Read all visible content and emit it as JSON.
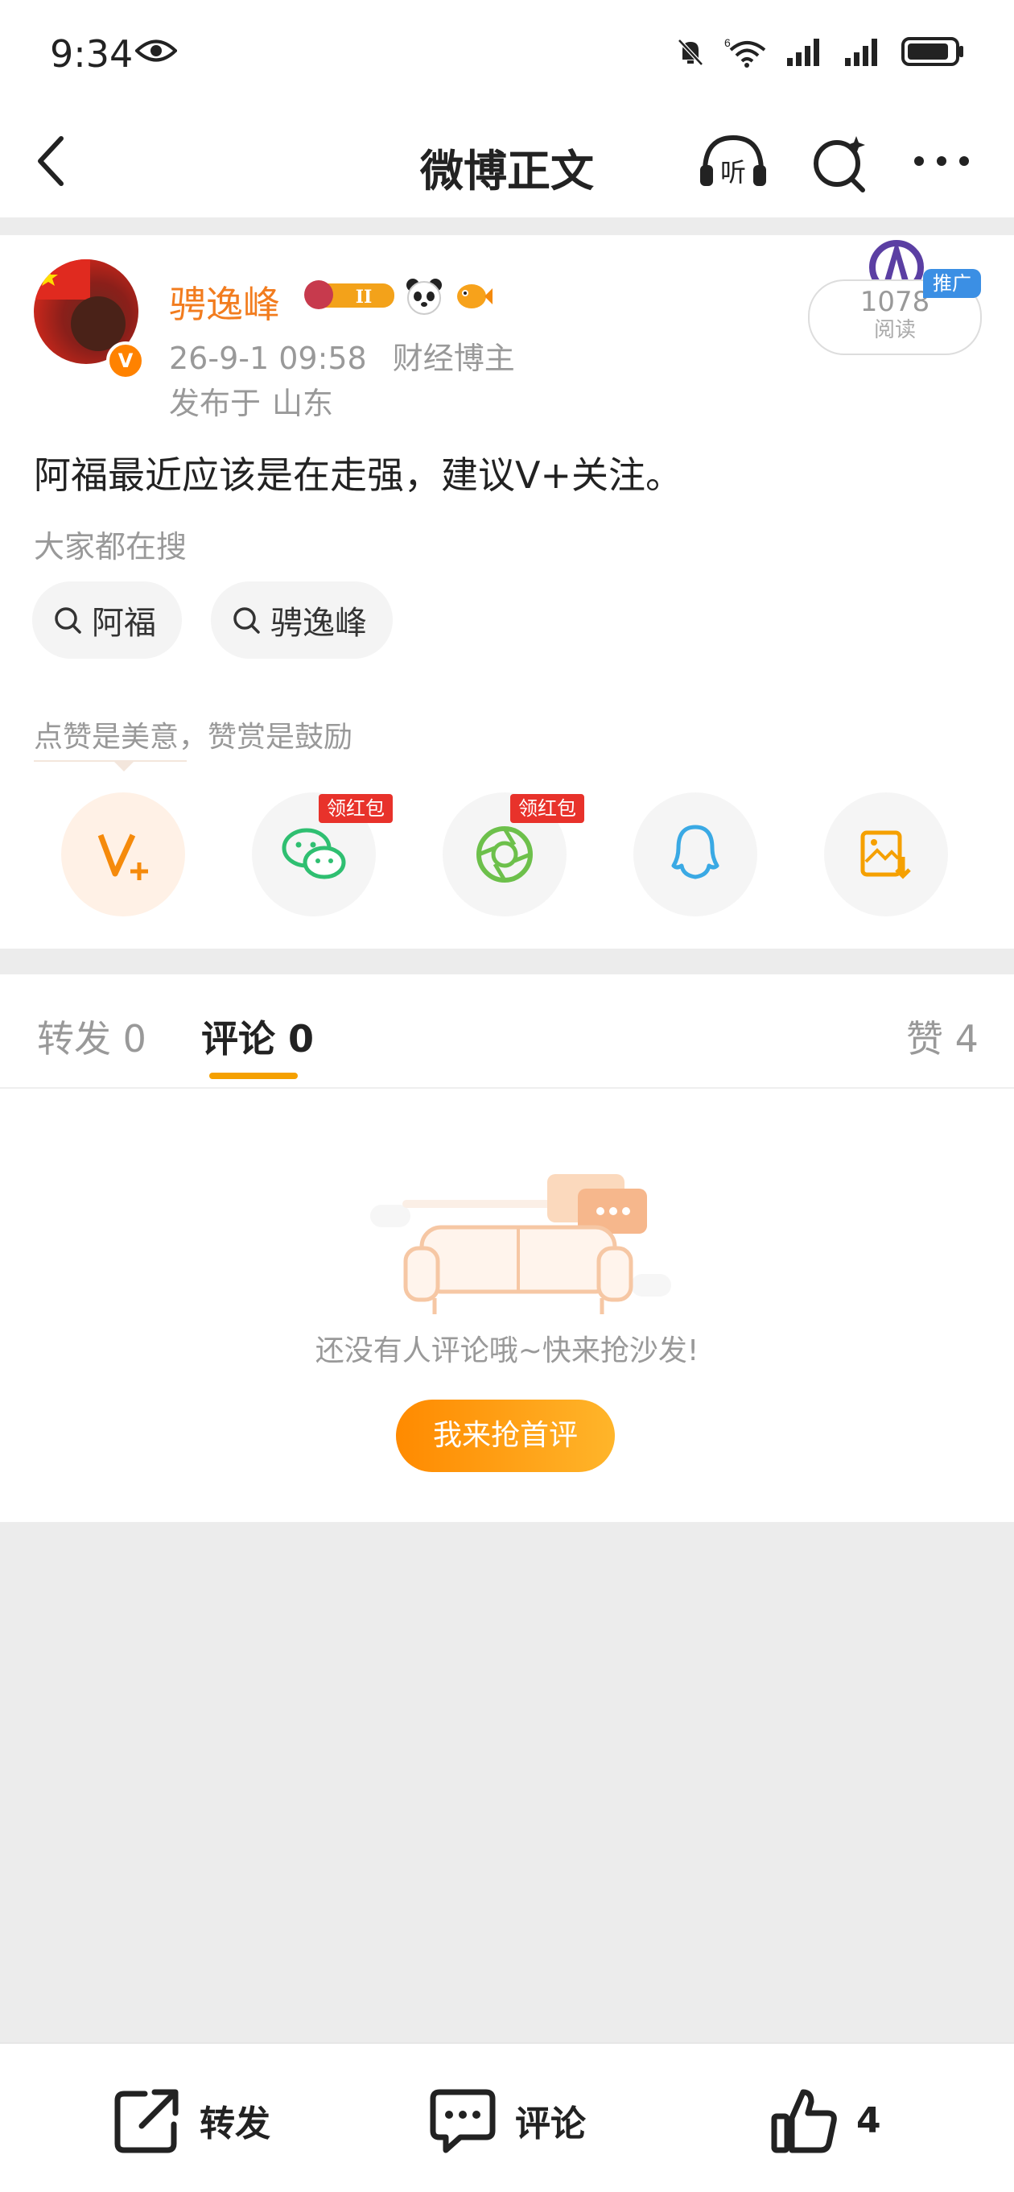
{
  "status_bar": {
    "time": "9:34",
    "network_label": "6"
  },
  "nav": {
    "title": "微博正文",
    "listen_label": "听"
  },
  "post": {
    "username": "骋逸峰",
    "level_badge": "II",
    "avatar_badge": "V",
    "time": "26-9-1 09:58",
    "role": "财经博主",
    "location_prefix": "发布于",
    "location": "山东",
    "reads_count": "1078",
    "reads_label": "阅读",
    "promo_tag": "推广",
    "content": "阿福最近应该是在走强，建议V+关注。",
    "hot_search_label": "大家都在搜",
    "hot_searches": [
      "阿福",
      "骋逸峰"
    ],
    "reward_tip": "点赞是美意，赞赏是鼓励",
    "share_targets": [
      {
        "name": "V+",
        "tag": ""
      },
      {
        "name": "wechat",
        "tag": "领红包"
      },
      {
        "name": "moments",
        "tag": "领红包"
      },
      {
        "name": "qq",
        "tag": ""
      },
      {
        "name": "save-image",
        "tag": ""
      }
    ]
  },
  "tabs": {
    "repost": "转发 0",
    "comment": "评论 0",
    "like": "赞 4"
  },
  "empty": {
    "text": "还没有人评论哦~快来抢沙发!",
    "button": "我来抢首评"
  },
  "bottom_bar": {
    "repost": "转发",
    "comment": "评论",
    "like": "4"
  },
  "colors": {
    "accent": "#f5a000",
    "username": "#f27c1e",
    "red_tag": "#e8322b"
  }
}
